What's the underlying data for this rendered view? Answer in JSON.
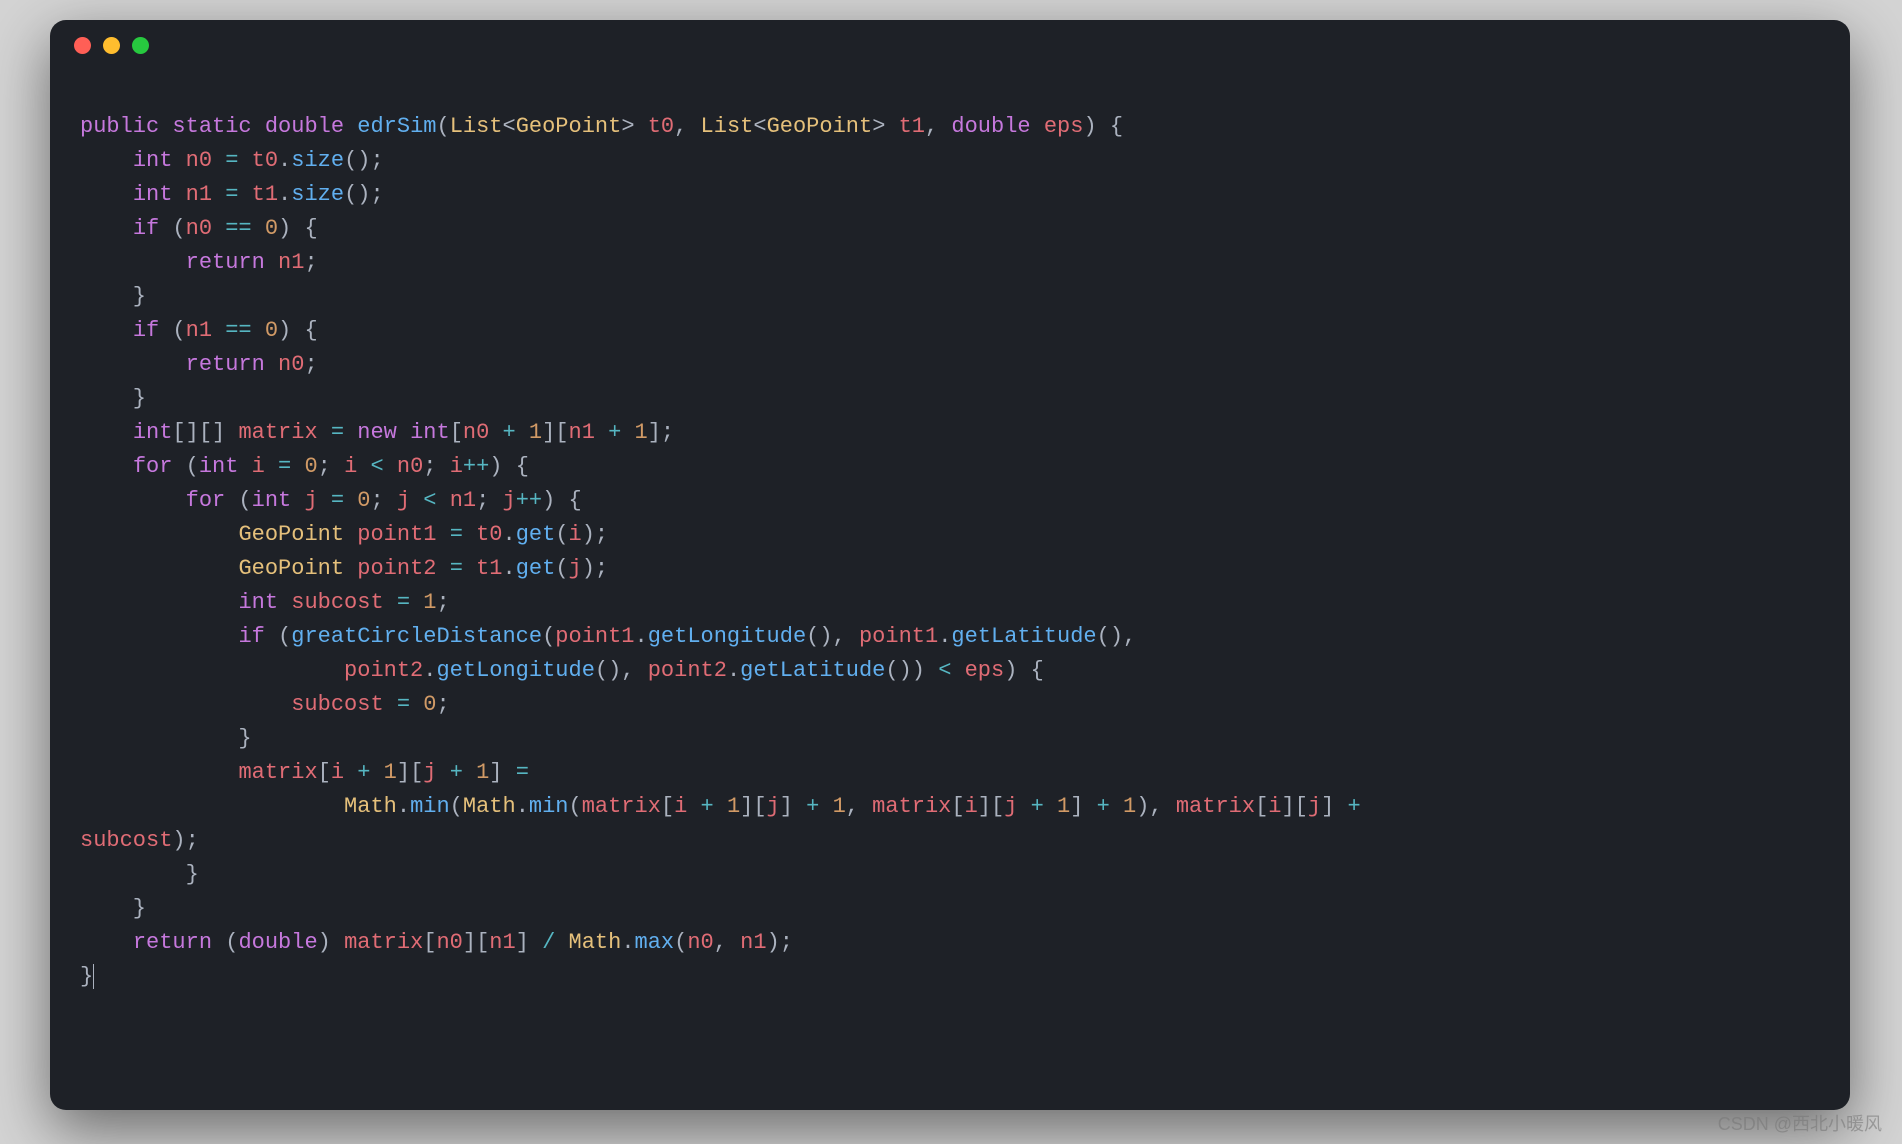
{
  "watermark": "CSDN @西北小暖风",
  "window": {
    "buttons": [
      "close",
      "minimize",
      "zoom"
    ]
  },
  "code": {
    "language": "java",
    "tokens": [
      [
        [
          "kw",
          "public"
        ],
        [
          "pun",
          " "
        ],
        [
          "kw",
          "static"
        ],
        [
          "pun",
          " "
        ],
        [
          "typ",
          "double"
        ],
        [
          "pun",
          " "
        ],
        [
          "fn",
          "edrSim"
        ],
        [
          "pun",
          "("
        ],
        [
          "cls",
          "List"
        ],
        [
          "pun",
          "<"
        ],
        [
          "cls",
          "GeoPoint"
        ],
        [
          "pun",
          "> "
        ],
        [
          "var",
          "t0"
        ],
        [
          "pun",
          ", "
        ],
        [
          "cls",
          "List"
        ],
        [
          "pun",
          "<"
        ],
        [
          "cls",
          "GeoPoint"
        ],
        [
          "pun",
          "> "
        ],
        [
          "var",
          "t1"
        ],
        [
          "pun",
          ", "
        ],
        [
          "typ",
          "double"
        ],
        [
          "pun",
          " "
        ],
        [
          "var",
          "eps"
        ],
        [
          "pun",
          ") {"
        ]
      ],
      [
        [
          "pun",
          "    "
        ],
        [
          "typ",
          "int"
        ],
        [
          "pun",
          " "
        ],
        [
          "var",
          "n0"
        ],
        [
          "pun",
          " "
        ],
        [
          "op",
          "="
        ],
        [
          "pun",
          " "
        ],
        [
          "var",
          "t0"
        ],
        [
          "pun",
          "."
        ],
        [
          "fn",
          "size"
        ],
        [
          "pun",
          "();"
        ]
      ],
      [
        [
          "pun",
          "    "
        ],
        [
          "typ",
          "int"
        ],
        [
          "pun",
          " "
        ],
        [
          "var",
          "n1"
        ],
        [
          "pun",
          " "
        ],
        [
          "op",
          "="
        ],
        [
          "pun",
          " "
        ],
        [
          "var",
          "t1"
        ],
        [
          "pun",
          "."
        ],
        [
          "fn",
          "size"
        ],
        [
          "pun",
          "();"
        ]
      ],
      [
        [
          "pun",
          "    "
        ],
        [
          "kw",
          "if"
        ],
        [
          "pun",
          " ("
        ],
        [
          "var",
          "n0"
        ],
        [
          "pun",
          " "
        ],
        [
          "op",
          "=="
        ],
        [
          "pun",
          " "
        ],
        [
          "num",
          "0"
        ],
        [
          "pun",
          ") {"
        ]
      ],
      [
        [
          "pun",
          "        "
        ],
        [
          "kw",
          "return"
        ],
        [
          "pun",
          " "
        ],
        [
          "var",
          "n1"
        ],
        [
          "pun",
          ";"
        ]
      ],
      [
        [
          "pun",
          "    }"
        ]
      ],
      [
        [
          "pun",
          "    "
        ],
        [
          "kw",
          "if"
        ],
        [
          "pun",
          " ("
        ],
        [
          "var",
          "n1"
        ],
        [
          "pun",
          " "
        ],
        [
          "op",
          "=="
        ],
        [
          "pun",
          " "
        ],
        [
          "num",
          "0"
        ],
        [
          "pun",
          ") {"
        ]
      ],
      [
        [
          "pun",
          "        "
        ],
        [
          "kw",
          "return"
        ],
        [
          "pun",
          " "
        ],
        [
          "var",
          "n0"
        ],
        [
          "pun",
          ";"
        ]
      ],
      [
        [
          "pun",
          "    }"
        ]
      ],
      [
        [
          "pun",
          "    "
        ],
        [
          "typ",
          "int"
        ],
        [
          "pun",
          "[][] "
        ],
        [
          "var",
          "matrix"
        ],
        [
          "pun",
          " "
        ],
        [
          "op",
          "="
        ],
        [
          "pun",
          " "
        ],
        [
          "kw",
          "new"
        ],
        [
          "pun",
          " "
        ],
        [
          "typ",
          "int"
        ],
        [
          "pun",
          "["
        ],
        [
          "var",
          "n0"
        ],
        [
          "pun",
          " "
        ],
        [
          "op",
          "+"
        ],
        [
          "pun",
          " "
        ],
        [
          "num",
          "1"
        ],
        [
          "pun",
          "]["
        ],
        [
          "var",
          "n1"
        ],
        [
          "pun",
          " "
        ],
        [
          "op",
          "+"
        ],
        [
          "pun",
          " "
        ],
        [
          "num",
          "1"
        ],
        [
          "pun",
          "];"
        ]
      ],
      [
        [
          "pun",
          "    "
        ],
        [
          "kw",
          "for"
        ],
        [
          "pun",
          " ("
        ],
        [
          "typ",
          "int"
        ],
        [
          "pun",
          " "
        ],
        [
          "var",
          "i"
        ],
        [
          "pun",
          " "
        ],
        [
          "op",
          "="
        ],
        [
          "pun",
          " "
        ],
        [
          "num",
          "0"
        ],
        [
          "pun",
          "; "
        ],
        [
          "var",
          "i"
        ],
        [
          "pun",
          " "
        ],
        [
          "op",
          "<"
        ],
        [
          "pun",
          " "
        ],
        [
          "var",
          "n0"
        ],
        [
          "pun",
          "; "
        ],
        [
          "var",
          "i"
        ],
        [
          "op",
          "++"
        ],
        [
          "pun",
          ") {"
        ]
      ],
      [
        [
          "pun",
          "        "
        ],
        [
          "kw",
          "for"
        ],
        [
          "pun",
          " ("
        ],
        [
          "typ",
          "int"
        ],
        [
          "pun",
          " "
        ],
        [
          "var",
          "j"
        ],
        [
          "pun",
          " "
        ],
        [
          "op",
          "="
        ],
        [
          "pun",
          " "
        ],
        [
          "num",
          "0"
        ],
        [
          "pun",
          "; "
        ],
        [
          "var",
          "j"
        ],
        [
          "pun",
          " "
        ],
        [
          "op",
          "<"
        ],
        [
          "pun",
          " "
        ],
        [
          "var",
          "n1"
        ],
        [
          "pun",
          "; "
        ],
        [
          "var",
          "j"
        ],
        [
          "op",
          "++"
        ],
        [
          "pun",
          ") {"
        ]
      ],
      [
        [
          "pun",
          "            "
        ],
        [
          "cls",
          "GeoPoint"
        ],
        [
          "pun",
          " "
        ],
        [
          "var",
          "point1"
        ],
        [
          "pun",
          " "
        ],
        [
          "op",
          "="
        ],
        [
          "pun",
          " "
        ],
        [
          "var",
          "t0"
        ],
        [
          "pun",
          "."
        ],
        [
          "fn",
          "get"
        ],
        [
          "pun",
          "("
        ],
        [
          "var",
          "i"
        ],
        [
          "pun",
          ");"
        ]
      ],
      [
        [
          "pun",
          "            "
        ],
        [
          "cls",
          "GeoPoint"
        ],
        [
          "pun",
          " "
        ],
        [
          "var",
          "point2"
        ],
        [
          "pun",
          " "
        ],
        [
          "op",
          "="
        ],
        [
          "pun",
          " "
        ],
        [
          "var",
          "t1"
        ],
        [
          "pun",
          "."
        ],
        [
          "fn",
          "get"
        ],
        [
          "pun",
          "("
        ],
        [
          "var",
          "j"
        ],
        [
          "pun",
          ");"
        ]
      ],
      [
        [
          "pun",
          "            "
        ],
        [
          "typ",
          "int"
        ],
        [
          "pun",
          " "
        ],
        [
          "var",
          "subcost"
        ],
        [
          "pun",
          " "
        ],
        [
          "op",
          "="
        ],
        [
          "pun",
          " "
        ],
        [
          "num",
          "1"
        ],
        [
          "pun",
          ";"
        ]
      ],
      [
        [
          "pun",
          "            "
        ],
        [
          "kw",
          "if"
        ],
        [
          "pun",
          " ("
        ],
        [
          "fn",
          "greatCircleDistance"
        ],
        [
          "pun",
          "("
        ],
        [
          "var",
          "point1"
        ],
        [
          "pun",
          "."
        ],
        [
          "fn",
          "getLongitude"
        ],
        [
          "pun",
          "(), "
        ],
        [
          "var",
          "point1"
        ],
        [
          "pun",
          "."
        ],
        [
          "fn",
          "getLatitude"
        ],
        [
          "pun",
          "(),"
        ]
      ],
      [
        [
          "pun",
          "                    "
        ],
        [
          "var",
          "point2"
        ],
        [
          "pun",
          "."
        ],
        [
          "fn",
          "getLongitude"
        ],
        [
          "pun",
          "(), "
        ],
        [
          "var",
          "point2"
        ],
        [
          "pun",
          "."
        ],
        [
          "fn",
          "getLatitude"
        ],
        [
          "pun",
          "()) "
        ],
        [
          "op",
          "<"
        ],
        [
          "pun",
          " "
        ],
        [
          "var",
          "eps"
        ],
        [
          "pun",
          ") {"
        ]
      ],
      [
        [
          "pun",
          "                "
        ],
        [
          "var",
          "subcost"
        ],
        [
          "pun",
          " "
        ],
        [
          "op",
          "="
        ],
        [
          "pun",
          " "
        ],
        [
          "num",
          "0"
        ],
        [
          "pun",
          ";"
        ]
      ],
      [
        [
          "pun",
          "            }"
        ]
      ],
      [
        [
          "pun",
          "            "
        ],
        [
          "var",
          "matrix"
        ],
        [
          "pun",
          "["
        ],
        [
          "var",
          "i"
        ],
        [
          "pun",
          " "
        ],
        [
          "op",
          "+"
        ],
        [
          "pun",
          " "
        ],
        [
          "num",
          "1"
        ],
        [
          "pun",
          "]["
        ],
        [
          "var",
          "j"
        ],
        [
          "pun",
          " "
        ],
        [
          "op",
          "+"
        ],
        [
          "pun",
          " "
        ],
        [
          "num",
          "1"
        ],
        [
          "pun",
          "] "
        ],
        [
          "op",
          "="
        ]
      ],
      [
        [
          "pun",
          "                    "
        ],
        [
          "cls",
          "Math"
        ],
        [
          "pun",
          "."
        ],
        [
          "fn",
          "min"
        ],
        [
          "pun",
          "("
        ],
        [
          "cls",
          "Math"
        ],
        [
          "pun",
          "."
        ],
        [
          "fn",
          "min"
        ],
        [
          "pun",
          "("
        ],
        [
          "var",
          "matrix"
        ],
        [
          "pun",
          "["
        ],
        [
          "var",
          "i"
        ],
        [
          "pun",
          " "
        ],
        [
          "op",
          "+"
        ],
        [
          "pun",
          " "
        ],
        [
          "num",
          "1"
        ],
        [
          "pun",
          "]["
        ],
        [
          "var",
          "j"
        ],
        [
          "pun",
          "] "
        ],
        [
          "op",
          "+"
        ],
        [
          "pun",
          " "
        ],
        [
          "num",
          "1"
        ],
        [
          "pun",
          ", "
        ],
        [
          "var",
          "matrix"
        ],
        [
          "pun",
          "["
        ],
        [
          "var",
          "i"
        ],
        [
          "pun",
          "]["
        ],
        [
          "var",
          "j"
        ],
        [
          "pun",
          " "
        ],
        [
          "op",
          "+"
        ],
        [
          "pun",
          " "
        ],
        [
          "num",
          "1"
        ],
        [
          "pun",
          "] "
        ],
        [
          "op",
          "+"
        ],
        [
          "pun",
          " "
        ],
        [
          "num",
          "1"
        ],
        [
          "pun",
          "), "
        ],
        [
          "var",
          "matrix"
        ],
        [
          "pun",
          "["
        ],
        [
          "var",
          "i"
        ],
        [
          "pun",
          "]["
        ],
        [
          "var",
          "j"
        ],
        [
          "pun",
          "] "
        ],
        [
          "op",
          "+"
        ]
      ],
      [
        [
          "var",
          "subcost"
        ],
        [
          "pun",
          ");"
        ]
      ],
      [
        [
          "pun",
          "        }"
        ]
      ],
      [
        [
          "pun",
          "    }"
        ]
      ],
      [
        [
          "pun",
          "    "
        ],
        [
          "kw",
          "return"
        ],
        [
          "pun",
          " ("
        ],
        [
          "typ",
          "double"
        ],
        [
          "pun",
          ") "
        ],
        [
          "var",
          "matrix"
        ],
        [
          "pun",
          "["
        ],
        [
          "var",
          "n0"
        ],
        [
          "pun",
          "]["
        ],
        [
          "var",
          "n1"
        ],
        [
          "pun",
          "] "
        ],
        [
          "op",
          "/"
        ],
        [
          "pun",
          " "
        ],
        [
          "cls",
          "Math"
        ],
        [
          "pun",
          "."
        ],
        [
          "fn",
          "max"
        ],
        [
          "pun",
          "("
        ],
        [
          "var",
          "n0"
        ],
        [
          "pun",
          ", "
        ],
        [
          "var",
          "n1"
        ],
        [
          "pun",
          ");"
        ]
      ],
      [
        [
          "pun",
          "}"
        ],
        [
          "cursor",
          ""
        ]
      ]
    ]
  }
}
